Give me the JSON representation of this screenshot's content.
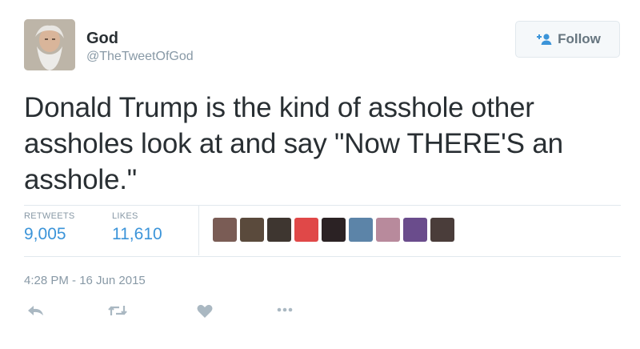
{
  "author": {
    "name": "God",
    "handle": "@TheTweetOfGod"
  },
  "follow_button": {
    "label": "Follow",
    "icon": "follow-user-icon"
  },
  "tweet": {
    "text": "Donald Trump is the kind of asshole other assholes look at and say \"Now THERE'S an asshole.\""
  },
  "stats": {
    "retweets_label": "RETWEETS",
    "retweets_value": "9,005",
    "likes_label": "LIKES",
    "likes_value": "11,610"
  },
  "likers": [
    {
      "color": "#7a5c55"
    },
    {
      "color": "#5a4a3c"
    },
    {
      "color": "#3e3630"
    },
    {
      "color": "#e04848"
    },
    {
      "color": "#2b2224"
    },
    {
      "color": "#5c84a8"
    },
    {
      "color": "#b88a9c"
    },
    {
      "color": "#6a4c8c"
    },
    {
      "color": "#4a3d3a"
    }
  ],
  "timestamp": "4:28 PM - 16 Jun 2015",
  "actions": [
    "reply-icon",
    "retweet-icon",
    "like-icon",
    "more-icon"
  ],
  "colors": {
    "accent": "#3b94d9",
    "muted": "#8899a6",
    "text": "#292f33",
    "border": "#e1e8ed"
  }
}
